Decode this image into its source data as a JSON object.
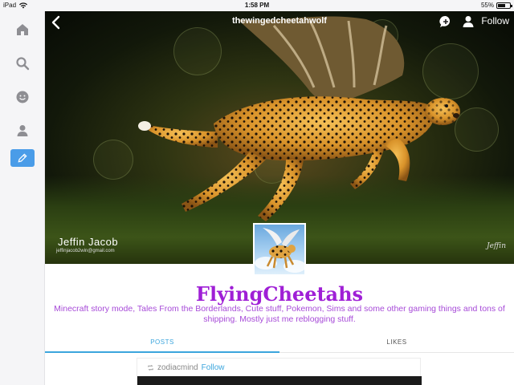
{
  "status_bar": {
    "device": "iPad",
    "time": "1:58 PM",
    "battery": "55%",
    "battery_fraction": 0.55
  },
  "sidebar": {
    "items": [
      {
        "name": "home-icon",
        "active": false
      },
      {
        "name": "search-icon",
        "active": false
      },
      {
        "name": "activity-icon",
        "active": false
      },
      {
        "name": "account-icon",
        "active": false
      },
      {
        "name": "compose-icon",
        "active": true
      }
    ]
  },
  "header": {
    "blog_url": "thewingedcheetahwolf",
    "follow_label": "Follow",
    "watermark_name": "Jeffin Jacob",
    "watermark_email": "jeffinjacob2win@gmail.com",
    "watermark_signature": "Jeffin"
  },
  "profile": {
    "title": "FlyingCheetahs",
    "description": "Minecraft story mode, Tales From the Borderlands, Cute stuff, Pokemon, Sims and some other gaming things and tons of shipping. Mostly just me reblogging stuff."
  },
  "tabs": [
    {
      "label": "POSTS",
      "active": true
    },
    {
      "label": "LIKES",
      "active": false
    }
  ],
  "post": {
    "reblogged_from": "zodiacmind",
    "follow_label": "Follow"
  },
  "colors": {
    "accent": "#3ba5dd",
    "title": "#9f1fd6",
    "description": "#a74bd8",
    "active_sidebar": "#4a9ce8"
  }
}
